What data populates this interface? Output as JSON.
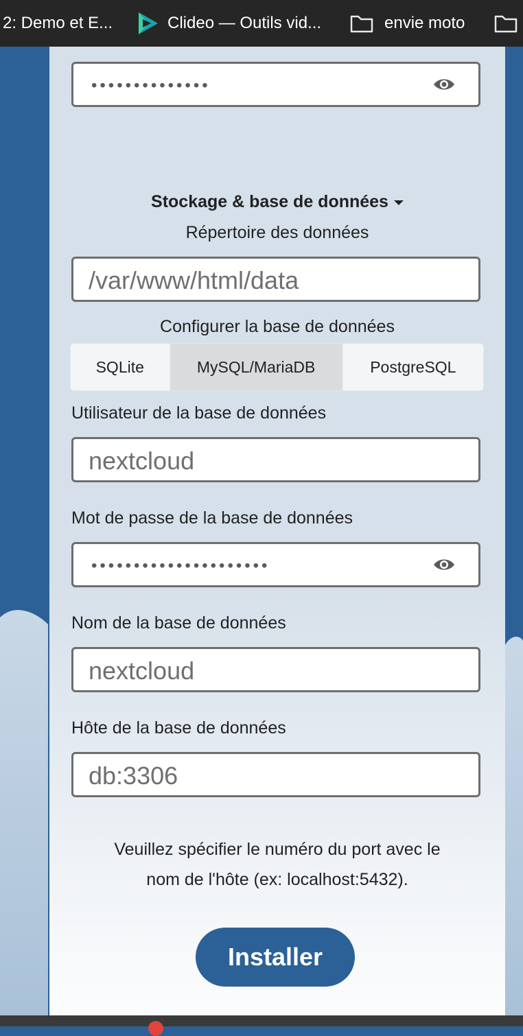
{
  "bookmarks": [
    {
      "label": "2: Demo et E...",
      "icon": "none"
    },
    {
      "label": "Clideo — Outils vid...",
      "icon": "clideo-play-icon"
    },
    {
      "label": "envie moto",
      "icon": "folder-icon"
    },
    {
      "label": "",
      "icon": "folder-icon"
    }
  ],
  "top_password": {
    "dots": "••••••••••••••"
  },
  "storage": {
    "title": "Stockage & base de données",
    "data_dir_label": "Répertoire des données",
    "data_dir_value": "/var/www/html/data"
  },
  "db_config": {
    "label": "Configurer la base de données",
    "tabs": [
      {
        "label": "SQLite",
        "active": false
      },
      {
        "label": "MySQL/MariaDB",
        "active": true
      },
      {
        "label": "PostgreSQL",
        "active": false
      }
    ]
  },
  "db_user": {
    "label": "Utilisateur de la base de données",
    "value": "nextcloud"
  },
  "db_password": {
    "label": "Mot de passe de la base de données",
    "dots": "•••••••••••••••••••••"
  },
  "db_name": {
    "label": "Nom de la base de données",
    "value": "nextcloud"
  },
  "db_host": {
    "label": "Hôte de la base de données",
    "value": "db:3306"
  },
  "hint": {
    "line1": "Veuillez spécifier le numéro du port avec le",
    "line2": "nom de l'hôte (ex: localhost:5432)."
  },
  "install_label": "Installer",
  "colors": {
    "primary": "#2c6197",
    "bookmarks_bg": "#262626",
    "card_bg": "#d6e0ea"
  }
}
